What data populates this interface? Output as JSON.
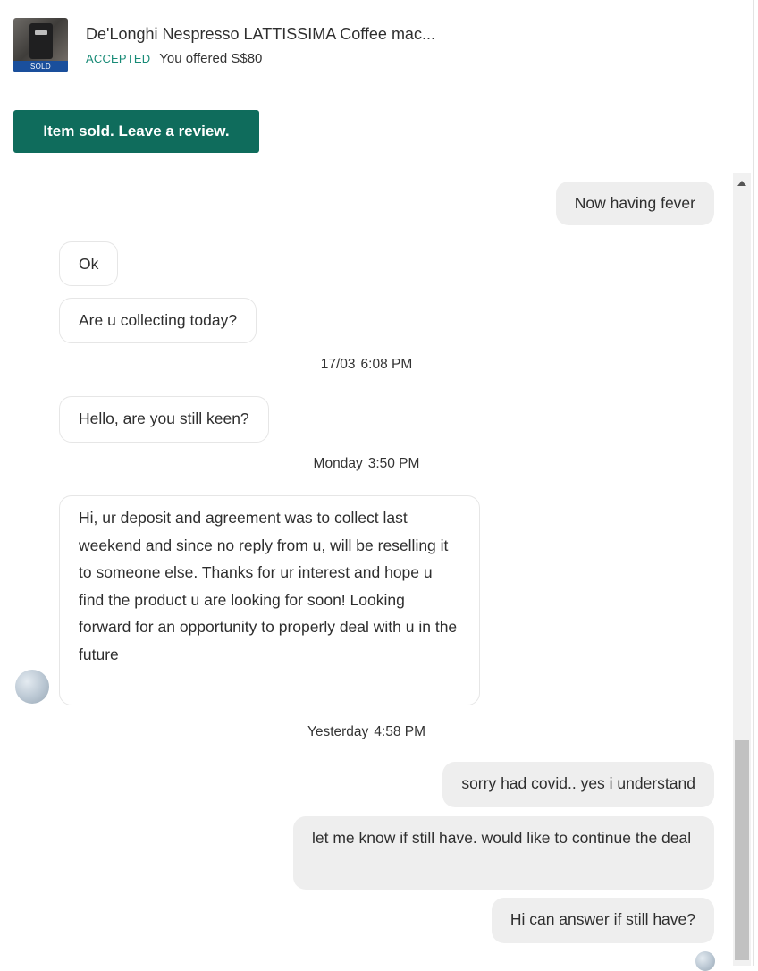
{
  "listing": {
    "title": "De'Longhi Nespresso LATTISSIMA Coffee mac...",
    "sold_badge": "SOLD",
    "status": "ACCEPTED",
    "offer_text": "You offered S$80"
  },
  "actions": {
    "review_button": "Item sold. Leave a review."
  },
  "messages": [
    {
      "from": "me",
      "text": "Now having fever"
    },
    {
      "from": "them",
      "text": "Ok"
    },
    {
      "from": "them",
      "text": "Are u collecting today?"
    },
    {
      "from": "them",
      "text": "Hello, are you still keen?"
    },
    {
      "from": "them",
      "text": "Hi, ur deposit and agreement was to collect last weekend and since no reply from u, will be reselling it to someone else. Thanks for ur interest and hope u find the product u are looking for soon! Looking forward for an opportunity to properly deal with u in the future"
    },
    {
      "from": "me",
      "text": "sorry had covid.. yes i understand"
    },
    {
      "from": "me",
      "text": "let me know if still have. would like to continue the deal"
    },
    {
      "from": "me",
      "text": "Hi can answer if still have?"
    }
  ],
  "timestamps": [
    {
      "day": "17/03",
      "time": "6:08 PM"
    },
    {
      "day": "Monday",
      "time": "3:50 PM"
    },
    {
      "day": "Yesterday",
      "time": "4:58 PM"
    }
  ]
}
